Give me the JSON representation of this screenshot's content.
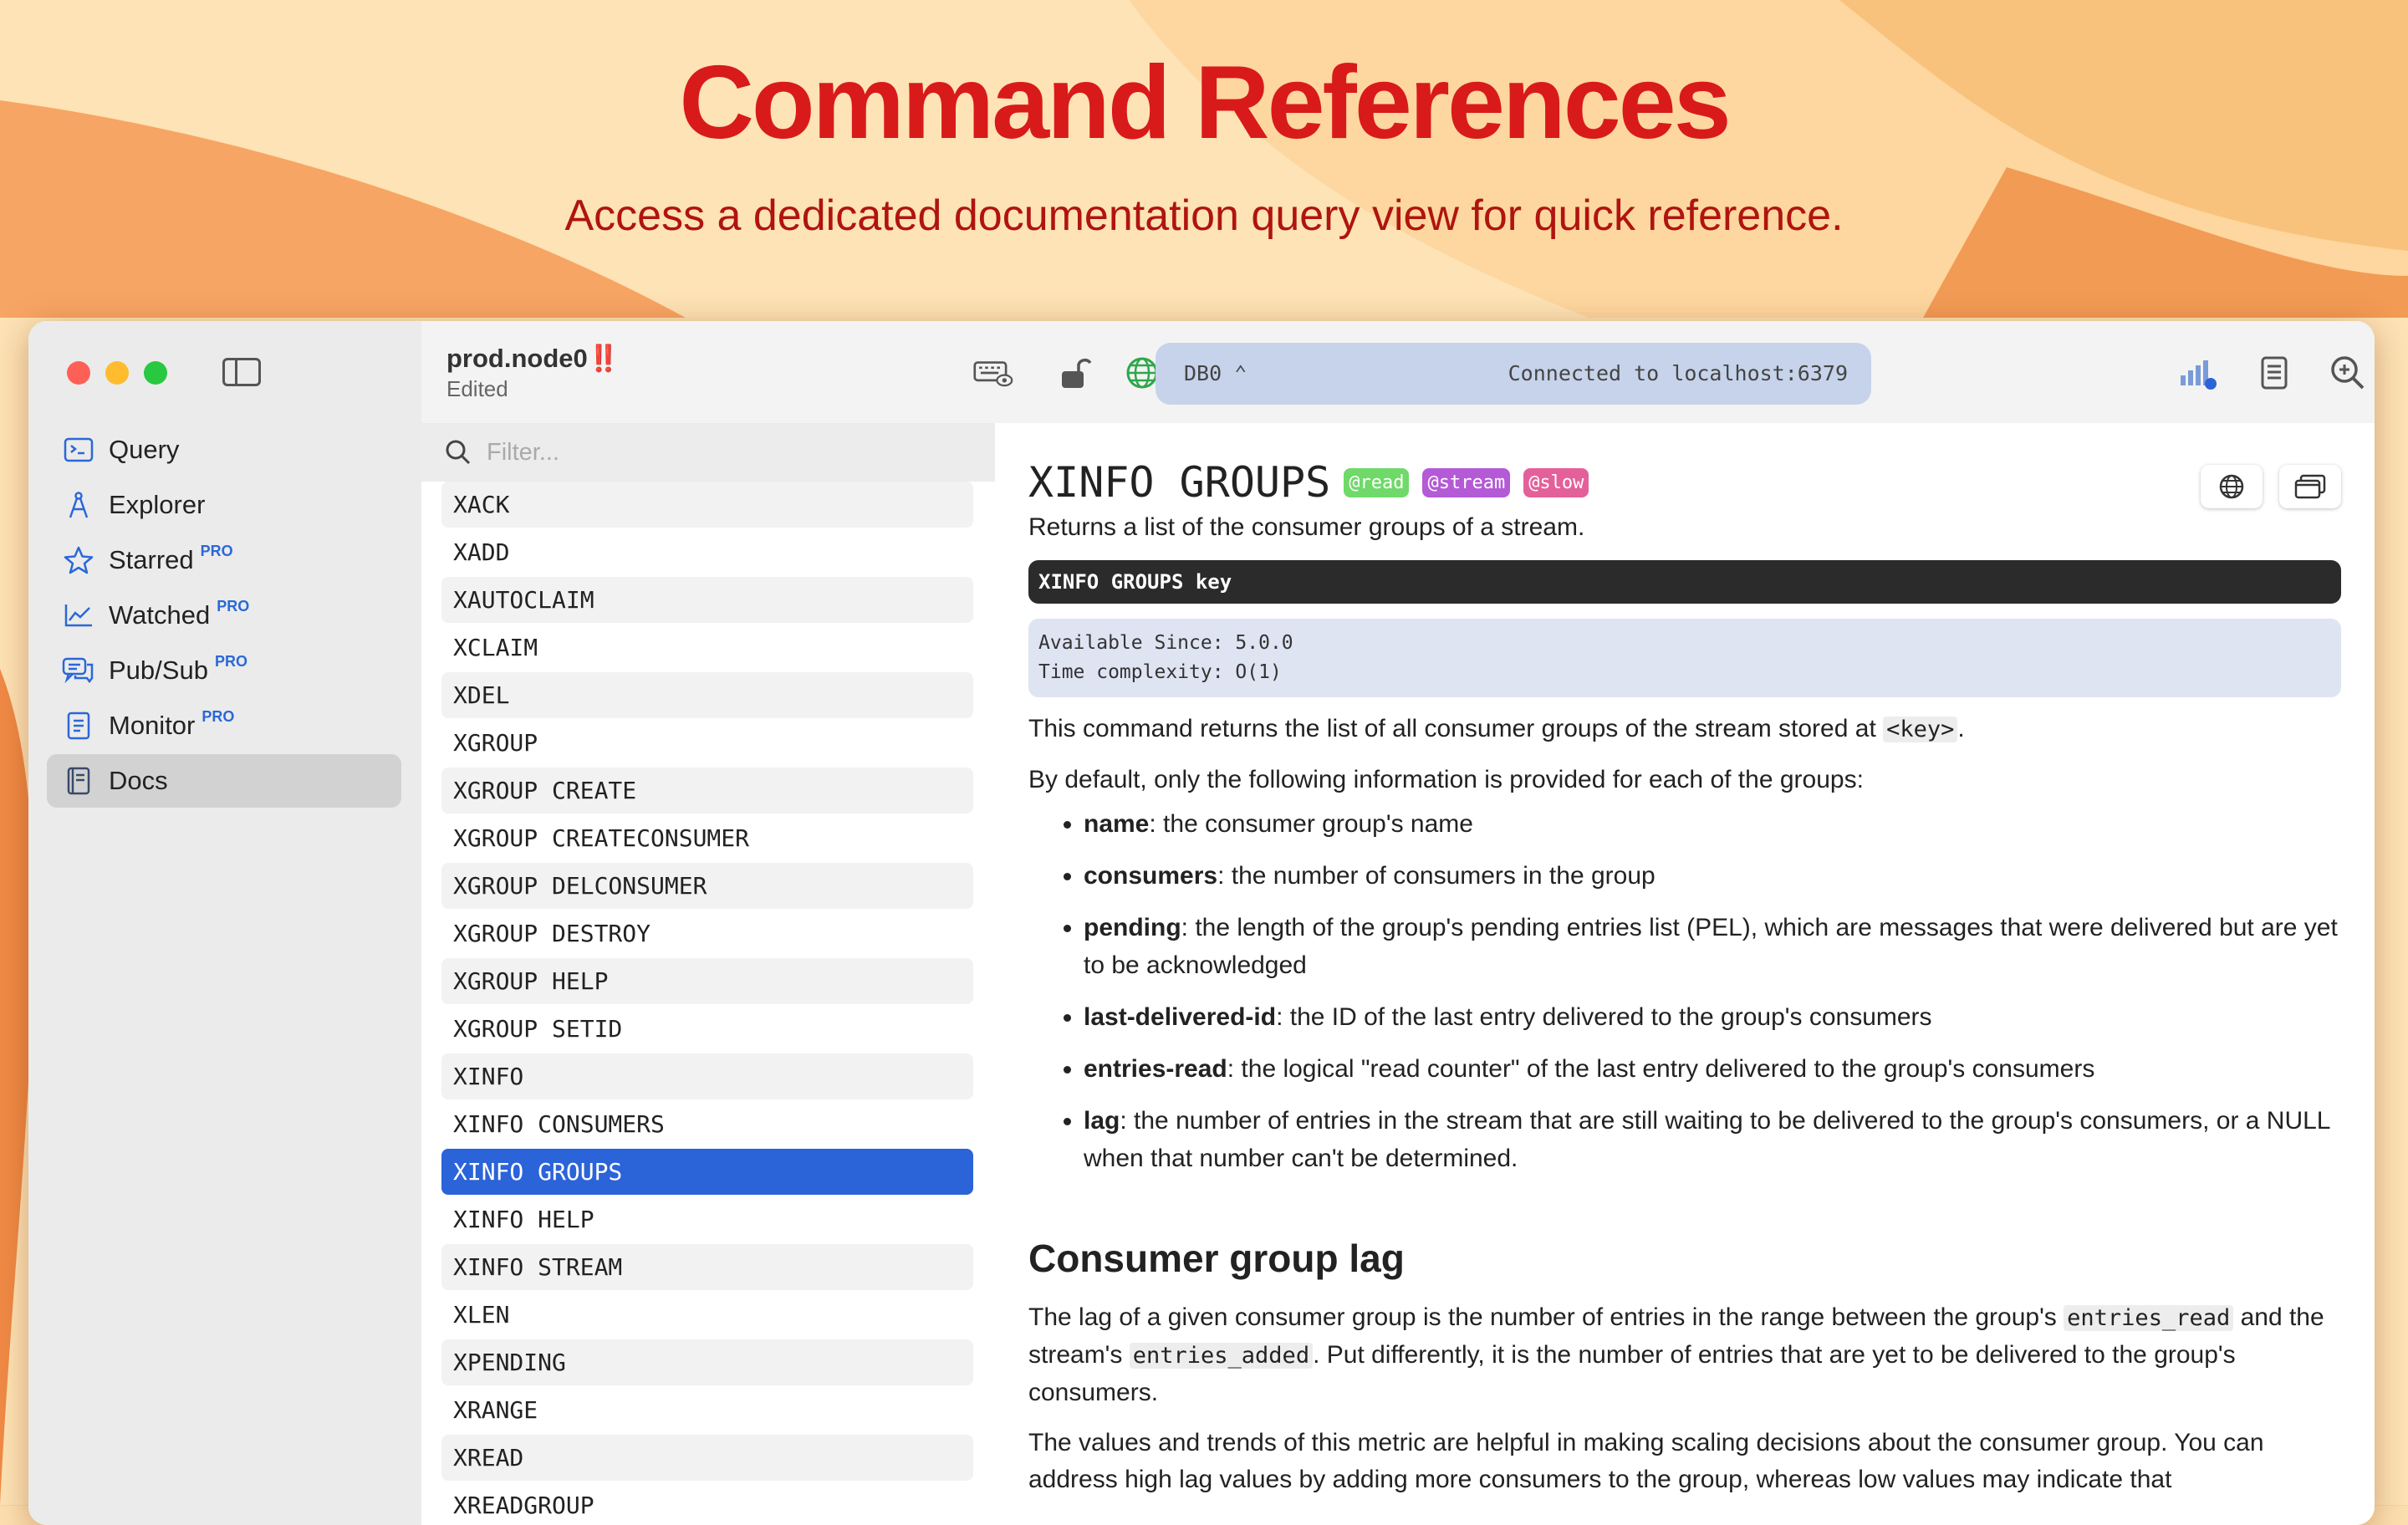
{
  "hero": {
    "title": "Command References",
    "subtitle": "Access a dedicated documentation query view for quick reference."
  },
  "sidebar": {
    "items": [
      {
        "label": "Query",
        "icon": "terminal-icon",
        "pro": ""
      },
      {
        "label": "Explorer",
        "icon": "compass-icon",
        "pro": ""
      },
      {
        "label": "Starred",
        "icon": "star-icon",
        "pro": "PRO"
      },
      {
        "label": "Watched",
        "icon": "chart-line-icon",
        "pro": "PRO"
      },
      {
        "label": "Pub/Sub",
        "icon": "chat-bubbles-icon",
        "pro": "PRO"
      },
      {
        "label": "Monitor",
        "icon": "monitor-doc-icon",
        "pro": "PRO"
      },
      {
        "label": "Docs",
        "icon": "book-icon",
        "pro": ""
      }
    ],
    "active": "Docs"
  },
  "toolbar": {
    "connection_name": "prod.node0",
    "connection_flag": "‼️",
    "connection_state": "Edited",
    "db_selector": "DB0 ⌃",
    "status": "Connected to localhost:6379"
  },
  "filter": {
    "placeholder": "Filter..."
  },
  "commands": [
    "XACK",
    "XADD",
    "XAUTOCLAIM",
    "XCLAIM",
    "XDEL",
    "XGROUP",
    "XGROUP CREATE",
    "XGROUP CREATECONSUMER",
    "XGROUP DELCONSUMER",
    "XGROUP DESTROY",
    "XGROUP HELP",
    "XGROUP SETID",
    "XINFO",
    "XINFO CONSUMERS",
    "XINFO GROUPS",
    "XINFO HELP",
    "XINFO STREAM",
    "XLEN",
    "XPENDING",
    "XRANGE",
    "XREAD",
    "XREADGROUP"
  ],
  "selected_command": "XINFO GROUPS",
  "doc": {
    "title": "XINFO GROUPS",
    "tags": [
      {
        "label": "@read",
        "color": "#6fd96a"
      },
      {
        "label": "@stream",
        "color": "#b45ad6"
      },
      {
        "label": "@slow",
        "color": "#e4609a"
      }
    ],
    "summary": "Returns a list of the consumer groups of a stream.",
    "syntax": "XINFO GROUPS key",
    "available_since": "Available Since: 5.0.0",
    "time_complexity": "Time complexity: O(1)",
    "intro_before": "This command returns the list of all consumer groups of the stream stored at ",
    "intro_code": "<key>",
    "intro_after": ".",
    "default_info": "By default, only the following information is provided for each of the groups:",
    "fields": [
      {
        "name": "name",
        "desc": ": the consumer group's name"
      },
      {
        "name": "consumers",
        "desc": ": the number of consumers in the group"
      },
      {
        "name": "pending",
        "desc": ": the length of the group's pending entries list (PEL), which are messages that were delivered but are yet to be acknowledged"
      },
      {
        "name": "last-delivered-id",
        "desc": ": the ID of the last entry delivered to the group's consumers"
      },
      {
        "name": "entries-read",
        "desc": ": the logical \"read counter\" of the last entry delivered to the group's consumers"
      },
      {
        "name": "lag",
        "desc": ": the number of entries in the stream that are still waiting to be delivered to the group's consumers, or a NULL when that number can't be determined."
      }
    ],
    "lag_heading": "Consumer group lag",
    "lag_p1_a": "The lag of a given consumer group is the number of entries in the range between the group's ",
    "lag_p1_code1": "entries_read",
    "lag_p1_b": " and the stream's ",
    "lag_p1_code2": "entries_added",
    "lag_p1_c": ". Put differently, it is the number of entries that are yet to be delivered to the group's consumers.",
    "lag_p2": "The values and trends of this metric are helpful in making scaling decisions about the consumer group. You can address high lag values by adding more consumers to the group, whereas low values may indicate that"
  }
}
